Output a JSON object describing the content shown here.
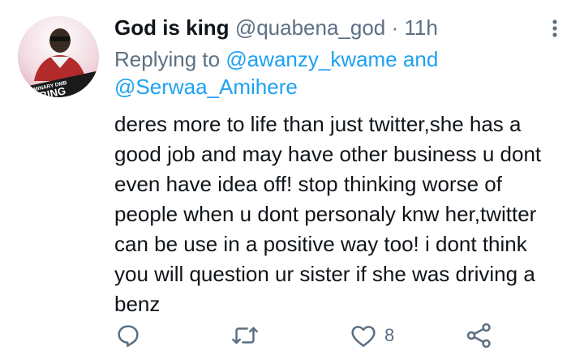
{
  "tweet": {
    "display_name": "God is king",
    "handle": "@quabena_god",
    "separator": "·",
    "time": "11h",
    "replying_prefix": "Replying to",
    "mentions": [
      "@awanzy_kwame",
      "@Serwaa_Amihere"
    ],
    "mention_joiner": "and",
    "body": "deres more to life than just twitter,she has a\ngood job and may have other business u dont\neven have idea off!  stop thinking worse of\npeople when u dont personaly knw her,twitter\ncan be use in a positive way too! i dont think\nyou will question ur sister if she was driving a\nbenz",
    "avatar_text_top": "LUMINARY DMB",
    "avatar_text_bottom": "AYA BING",
    "like_count": "8"
  },
  "icons": {
    "more": "more-vertical-icon",
    "reply": "reply-icon",
    "retweet": "retweet-icon",
    "like": "heart-icon",
    "share": "share-icon"
  },
  "colors": {
    "text": "#0f1419",
    "secondary": "#5b7083",
    "link": "#1da1f2"
  }
}
